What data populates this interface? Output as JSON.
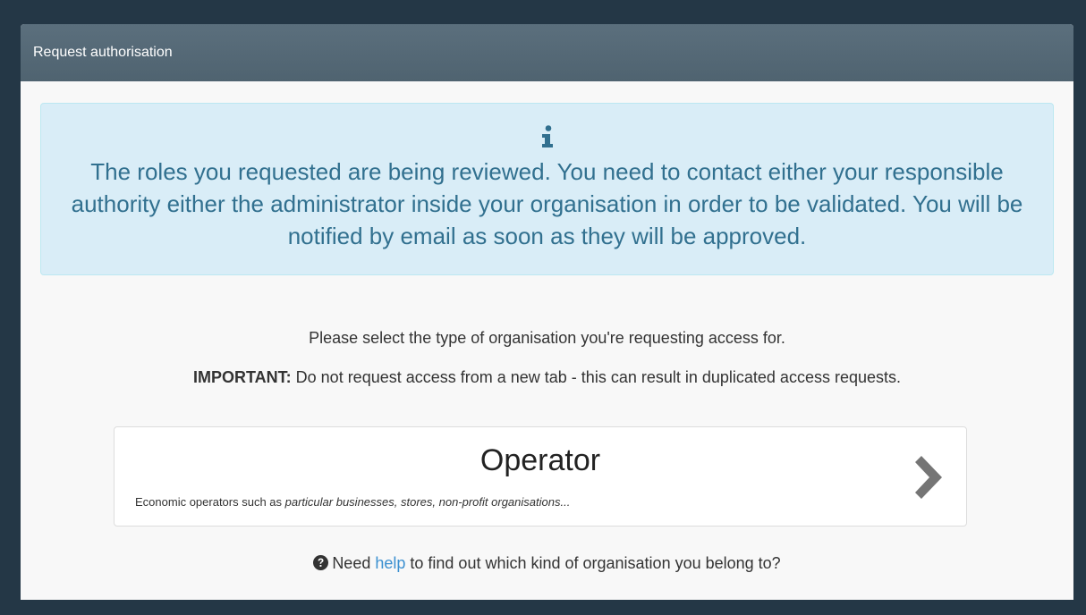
{
  "panel": {
    "title": "Request authorisation"
  },
  "alert": {
    "icon": "info-icon",
    "message": "The roles you requested are being reviewed. You need to contact either your responsible authority either the administrator inside your organisation in order to be validated. You will be notified by email as soon as they will be approved."
  },
  "instructions": {
    "select_text": "Please select the type of organisation you're requesting access for.",
    "important_label": "IMPORTANT:",
    "important_text": " Do not request access from a new tab - this can result in duplicated access requests."
  },
  "organisation_option": {
    "title": "Operator",
    "description_prefix": "Economic operators such as ",
    "description_examples": "particular businesses, stores, non-profit organisations...",
    "icon": "chevron-right-icon"
  },
  "help": {
    "icon": "question-circle-icon",
    "prefix": "Need ",
    "link_text": "help",
    "suffix": " to find out which kind of organisation you belong to?"
  },
  "colors": {
    "background": "#243746",
    "header": "#546a78",
    "alert_bg": "#d9edf7",
    "alert_text": "#31708f",
    "link": "#3a8fd0"
  }
}
